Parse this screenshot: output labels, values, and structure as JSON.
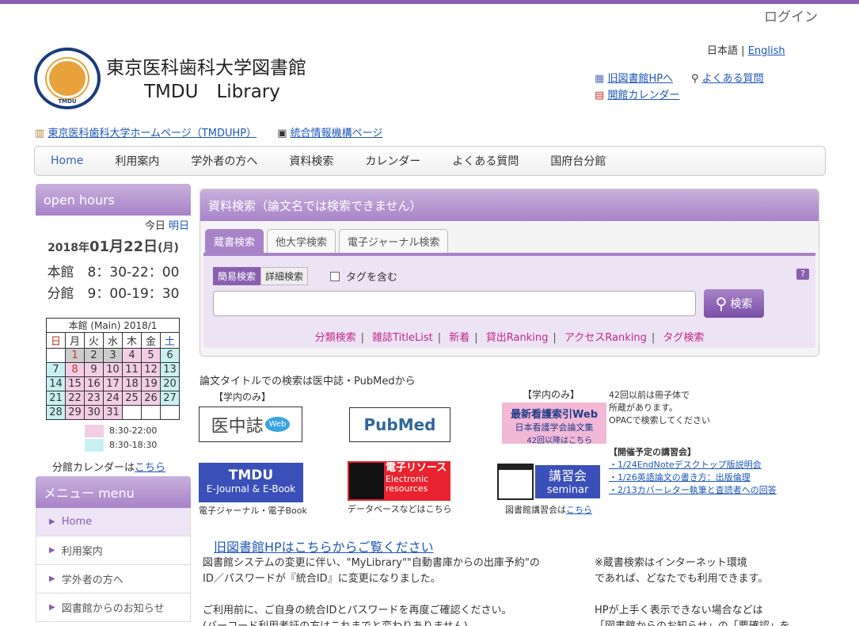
{
  "header": {
    "login": "ログイン",
    "title_jp": "東京医科歯科大学図書館",
    "title_en": "TMDU　Library",
    "logo_text": "TOKYO MEDICAL AND DENTAL UNIVERSITY",
    "logo_abbr": "TMDU",
    "lang_ja": "日本語",
    "lang_sep": "|",
    "lang_en": "English",
    "old_hp": "旧図書館HPへ",
    "faq": "よくある質問",
    "calendar": "開館カレンダー",
    "tmduhp": "東京医科歯科大学ホームページ（TMDUHP）",
    "itpage": "統合情報機構ページ"
  },
  "nav": [
    "Home",
    "利用案内",
    "学外者の方へ",
    "資料検索",
    "カレンダー",
    "よくある質問",
    "国府台分館"
  ],
  "hours": {
    "title": "open hours",
    "today": "今日",
    "tomorrow": "明日",
    "year": "2018年",
    "date": "01月22日",
    "dow": "(月)",
    "main": "本館　8：30-22：00",
    "branch": "分館　9：00-19：30"
  },
  "calendar": {
    "title": "本館 (Main) 2018/1",
    "dows": [
      "日",
      "月",
      "火",
      "水",
      "木",
      "金",
      "土"
    ],
    "rows": [
      [
        "",
        "1",
        "2",
        "3",
        "4",
        "5",
        "6"
      ],
      [
        "7",
        "8",
        "9",
        "10",
        "11",
        "12",
        "13"
      ],
      [
        "14",
        "15",
        "16",
        "17",
        "18",
        "19",
        "20"
      ],
      [
        "21",
        "22",
        "23",
        "24",
        "25",
        "26",
        "27"
      ],
      [
        "28",
        "29",
        "30",
        "31",
        "",
        "",
        ""
      ]
    ],
    "legend1": "8:30-22:00",
    "legend2": "8:30-18:30",
    "branch_cal": "分館カレンダーは",
    "here": "こちら"
  },
  "menu": {
    "title": "メニュー menu",
    "items": [
      "Home",
      "利用案内",
      "学外者の方へ",
      "図書館からのお知らせ"
    ]
  },
  "search": {
    "title": "資料検索（論文名では検索できません）",
    "tabs": [
      "蔵書検索",
      "他大学検索",
      "電子ジャーナル検索"
    ],
    "simple": "簡易検索",
    "detail": "詳細検索",
    "tag": "タグを含む",
    "button": "検索",
    "help": "?",
    "links": [
      "分類検索",
      "雑誌TitleList",
      "新着",
      "貸出Ranking",
      "アクセスRanking",
      "タグ検索"
    ]
  },
  "banners": {
    "intro": "論文タイトルでの検索は医中誌・PubMedから",
    "campus_only": "【学内のみ】",
    "campus_only2": "【学内のみ】",
    "ichushi": "医中誌",
    "web": "Web",
    "pubmed": "PubMed",
    "nursing1": "最新看護索引Web",
    "nursing2": "日本看護学会論文集",
    "nursing3": "42回以降はこちら",
    "nursing_note1": "42回以前は冊子体で",
    "nursing_note2": "所蔵があります。",
    "nursing_note3": "OPACで検索してください",
    "tmdu1": "TMDU",
    "tmdu2": "E-Journal & E-Book",
    "tmdu_cap": "電子ジャーナル・電子Book",
    "eres1": "電子リソース",
    "eres2": "Electronic",
    "eres3": "resources",
    "eres_cap": "データベースなどはこちら",
    "sem1": "講習会",
    "sem2": "seminar",
    "sem_cap": "図書館講習会は",
    "sem_here": "こちら"
  },
  "seminars": {
    "title": "【開催予定の講習会】",
    "items": [
      "・1/24EndNoteデスクトップ版説明会",
      "・1/26英語論文の書き方：出版倫理",
      "・2/13カバーレター執筆と査読者への回答"
    ]
  },
  "info": {
    "old_link": "旧図書館HPはこちらからご覧ください",
    "p1": "図書館システムの変更に伴い、\"MyLibrary\"\"自動書庫からの出庫予約\"の",
    "p2": "ID／パスワードが『統合ID』に変更になりました。",
    "p3": "ご利用前に、ご自身の統合IDとパスワードを再度ご確認ください。",
    "p4": "(バーコード利用者証の方はこれまでと変わりありません)",
    "r1": "※蔵書検索はインターネット環境",
    "r2": "であれば、どなたでも利用できます。",
    "r3": "HPが上手く表示できない場合などは",
    "r4": "「図書館からのお知らせ」の「要確認」を"
  }
}
